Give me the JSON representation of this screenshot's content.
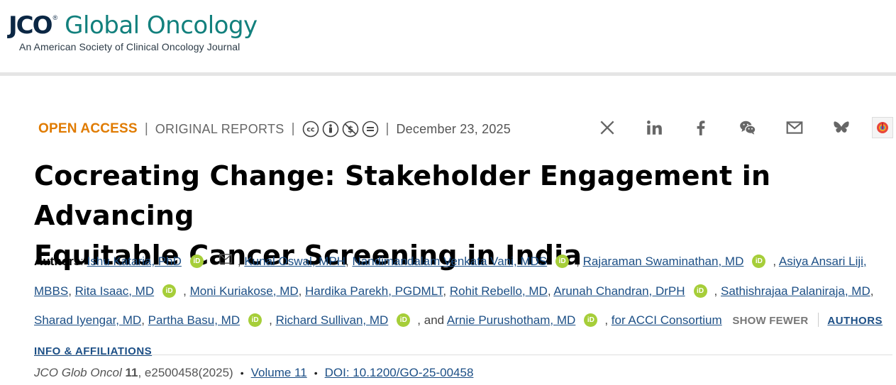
{
  "header": {
    "logo_jco": "JCO",
    "logo_reg": "®",
    "logo_title": "Global Oncology",
    "logo_subtitle": "An American Society of Clinical Oncology Journal"
  },
  "meta": {
    "open_access": "OPEN ACCESS",
    "sep": "|",
    "article_type": "ORIGINAL REPORTS",
    "license_icons": [
      "cc-icon",
      "by-icon",
      "nc-icon",
      "nd-icon"
    ],
    "date": "December 23, 2025"
  },
  "share": {
    "icons": [
      "x-icon",
      "linkedin-icon",
      "facebook-icon",
      "wechat-icon",
      "email-icon",
      "bluesky-icon",
      "altmetric-icon"
    ]
  },
  "article": {
    "title_line1": "Cocreating Change: Stakeholder Engagement in Advancing",
    "title_line2": "Equitable Cancer Screening in India"
  },
  "authors": {
    "label": "Authors",
    "colon": ":",
    "list": [
      "Ishu Kataria, PhD",
      "Kunal Oswal, MPH",
      "Nandimandalam Venkata Vani, MDS",
      "Rajaraman Swaminathan, MD",
      "Asiya Ansari Liji, MBBS",
      "Rita Isaac, MD",
      "Moni Kuriakose, MD",
      "Hardika Parekh, PGDMLT",
      "Rohit Rebello, MD",
      "Arunah Chandran, DrPH",
      "Sathishrajaa Palaniraja, MD",
      "Sharad Iyengar, MD",
      "Partha Basu, MD",
      "Richard Sullivan, MD",
      "Arnie Purushotham, MD",
      "for ACCI Consortium"
    ],
    "orcid_label": "iD",
    "and_text": ", and",
    "show_fewer": "SHOW FEWER",
    "affiliations": "AUTHORS INFO & AFFILIATIONS"
  },
  "citation": {
    "journal": "JCO Glob Oncol",
    "volume_num": "11",
    "article_id": ", e2500458(2025)",
    "bullet": "•",
    "volume_link": "Volume 11",
    "doi": "DOI: 10.1200/GO-25-00458"
  },
  "colors": {
    "accent_orange": "#e07b00",
    "brand_teal": "#12807d",
    "link_blue": "#1c4f86",
    "orcid_green": "#a6ce39"
  }
}
